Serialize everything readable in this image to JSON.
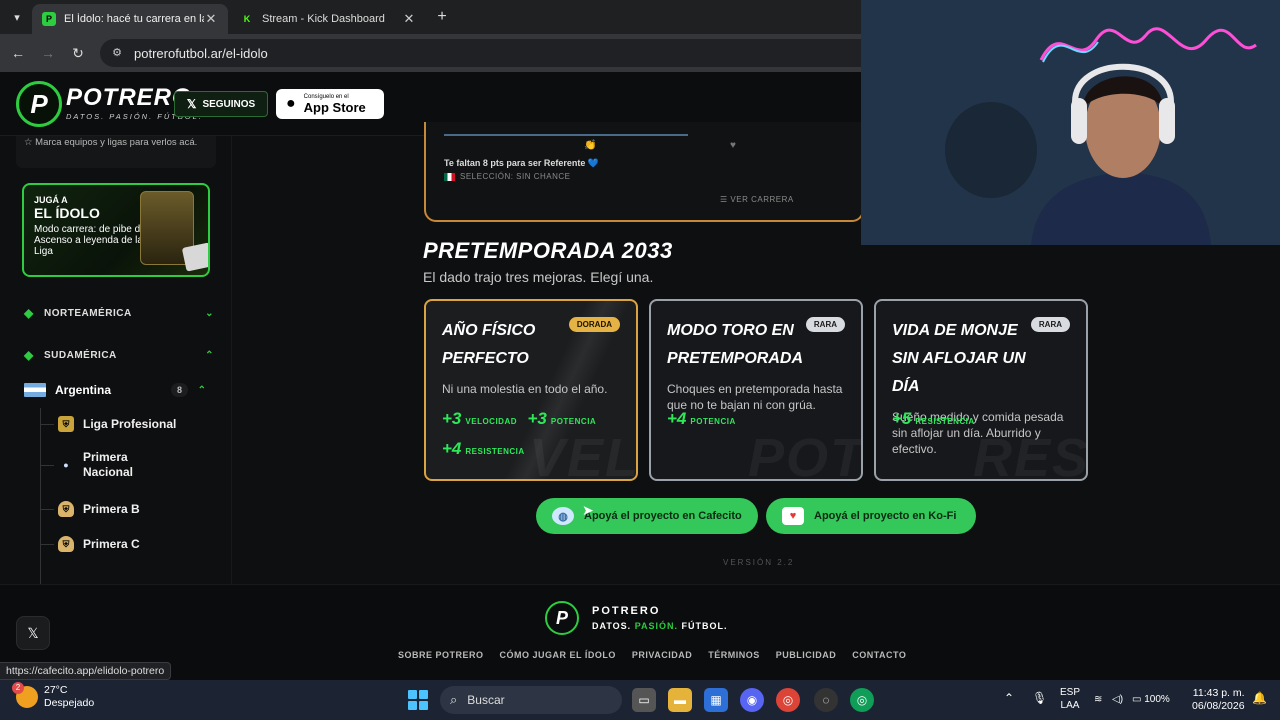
{
  "browser": {
    "tabs": [
      {
        "label": "El Ídolo: hacé tu carrera en la Liga",
        "favicon": "P",
        "active": true
      },
      {
        "label": "Stream - Kick Dashboard",
        "favicon": "K",
        "active": false
      }
    ],
    "url": "potrerofutbol.ar/el-idolo",
    "status_url": "https://cafecito.app/elidolo-potrero"
  },
  "header": {
    "logo_letter": "P",
    "brand": "POTRERO",
    "tagline": "DATOS. PASIÓN. FÚTBOL.",
    "follow_label": "SEGUINOS",
    "appstore_small": "Consíguelo en el",
    "appstore_big": "App Store"
  },
  "sidebar": {
    "hint": "Marca equipos y ligas para verlos acá.",
    "promo": {
      "kicker": "JUGÁ A",
      "title": "EL ÍDOLO",
      "text": "Modo carrera: de pibe del Ascenso a leyenda de la Liga"
    },
    "regions": [
      {
        "label": "NORTEAMÉRICA",
        "expanded": false
      },
      {
        "label": "SUDAMÉRICA",
        "expanded": true
      }
    ],
    "country": {
      "label": "Argentina",
      "count": "8"
    },
    "leagues": [
      {
        "label": "Liga Profesional"
      },
      {
        "label": "Primera Nacional"
      },
      {
        "label": "Primera B"
      },
      {
        "label": "Primera C"
      }
    ]
  },
  "career": {
    "needs": "Te faltan 8 pts para ser Referente 💙",
    "selection": "SELECCIÓN: SIN CHANCE",
    "view": "VER CARRERA"
  },
  "preseason": {
    "title": "PRETEMPORADA 2033",
    "subtitle": "El dado trajo tres mejoras. Elegí una.",
    "options": [
      {
        "title": "Año físico perfecto",
        "badge": "DORADA",
        "desc": "Ni una molestia en todo el año.",
        "bg_word": "VEL",
        "stats": [
          {
            "value": "+3",
            "name": "VELOCIDAD"
          },
          {
            "value": "+3",
            "name": "POTENCIA"
          },
          {
            "value": "+4",
            "name": "RESISTENCIA"
          }
        ]
      },
      {
        "title": "Modo toro en pretemporada",
        "badge": "RARA",
        "desc": "Choques en pretemporada hasta que no te bajan ni con grúa.",
        "bg_word": "POT",
        "stats": [
          {
            "value": "+4",
            "name": "POTENCIA"
          }
        ]
      },
      {
        "title": "Vida de monje sin aflojar un día",
        "badge": "RARA",
        "desc": "Sueño medido y comida pesada sin aflojar un día. Aburrido y efectivo.",
        "bg_word": "RES",
        "stats": [
          {
            "value": "+5",
            "name": "RESISTENCIA"
          }
        ]
      }
    ]
  },
  "support": {
    "cafecito": "Apoyá el proyecto en Cafecito",
    "kofi": "Apoyá el proyecto en Ko-Fi"
  },
  "version": "VERSIÓN 2.2",
  "footer": {
    "brand": "POTRERO",
    "tag_a": "DATOS.",
    "tag_b": "PASIÓN.",
    "tag_c": "FÚTBOL.",
    "links": [
      "SOBRE POTRERO",
      "CÓMO JUGAR EL ÍDOLO",
      "PRIVACIDAD",
      "TÉRMINOS",
      "PUBLICIDAD",
      "CONTACTO"
    ]
  },
  "taskbar": {
    "weather_badge": "2",
    "temp": "27°C",
    "condition": "Despejado",
    "search": "Buscar",
    "lang_top": "ESP",
    "lang_bottom": "LAA",
    "battery": "100%",
    "time": "11:43 p. m.",
    "date": "06/08/2026"
  },
  "colors": {
    "accent": "#2ecc40",
    "gold": "#d9a441",
    "rare": "#9ba1a8",
    "stat": "#2ee85a"
  }
}
